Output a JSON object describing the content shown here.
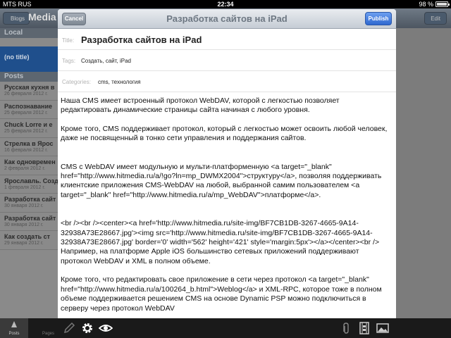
{
  "status": {
    "carrier": "MTS RUS",
    "time": "22:34",
    "battery_text": "98 %",
    "battery_level": 0.98
  },
  "background": {
    "blogs_button": "Blogs",
    "media_title": "Media",
    "edit_button": "Edit",
    "local_header": "Local",
    "no_title_item": "(no title)",
    "posts_header": "Posts",
    "posts": [
      {
        "title": "Русская кухня в",
        "date": "26 февраля 2012 г."
      },
      {
        "title": "Распознавание",
        "date": "25 февраля 2012 г."
      },
      {
        "title": "Chuck Lorre и е",
        "date": "25 февраля 2012 г."
      },
      {
        "title": "Стрелка в Ярос",
        "date": "16 февраля 2012 г."
      },
      {
        "title": "Как одновремен",
        "date": "2 февраля 2012 г."
      },
      {
        "title": "Ярославль. Созд",
        "date": "1 февраля 2012 г."
      },
      {
        "title": "Разработка сайт",
        "date": "30 января 2012 г."
      },
      {
        "title": "Разработка сайт",
        "date": "30 января 2012 г."
      },
      {
        "title": "Как создать ст",
        "date": "29 января 2012 г."
      }
    ]
  },
  "modal": {
    "cancel_label": "Cancel",
    "title": "Разработка сайтов на iPad",
    "publish_label": "Publish",
    "title_label": "Title:",
    "title_value": "Разработка сайтов на iPad",
    "tags_label": "Tags:",
    "tags_value": "Создать, сайт, iPad",
    "categories_label": "Categories:",
    "categories_value": "cms, технология",
    "paragraphs": [
      "Наша CMS  имеет встроенный протокол WebDAV, которой с легкостью позволяет редактировать динамические страницы сайта начиная с любого уровня.",
      "Кроме того, CMS поддерживает протокол, который с легкостью может освоить любой человек,  даже не посвященный в тонко сети управления и поддержания сайтов.",
      "CMS с WebDAV имеет модульную и мульти-платформенную <a target=\"_blank\" href=\"http://www.hitmedia.ru/a/!go?ln=mp_DWMX2004\">структуру</a>, позволяя поддерживать клиентские приложения CMS-WebDAV  на любой, выбранной самим пользователем <a target=\"_blank\" href=\"http://www.hitmedia.ru/a/mp_WebDAV\">платформе</a>.",
      "<br /><br /><center><a href='http://www.hitmedia.ru/site-img/BF7CB1DB-3267-4665-9A14-32938A73E28667.jpg'><img src='http://www.hitmedia.ru/site-img/BF7CB1DB-3267-4665-9A14-32938A73E28667.jpg' border='0' width='562' height='421' style='margin:5px'></a></center><br />\nНапример, на платформе Apple iOS большинство сетевых приложений поддерживают протокол WebDAV и XML в полном объеме.",
      "Кроме того, что редактировать свое приложение в сети через протокол <a target=\"_blank\" href=\"http://www.hitmedia.ru/a/100264_b.html\">Weblog</a> и XML-RPC, которое тоже в полном объеме поддерживается решением CMS на основе Dynamic PSP можно подключиться в серверу через протокол WebDAV"
    ]
  },
  "toolbar": {
    "posts_label": "Posts",
    "pages_label": "Pages"
  }
}
